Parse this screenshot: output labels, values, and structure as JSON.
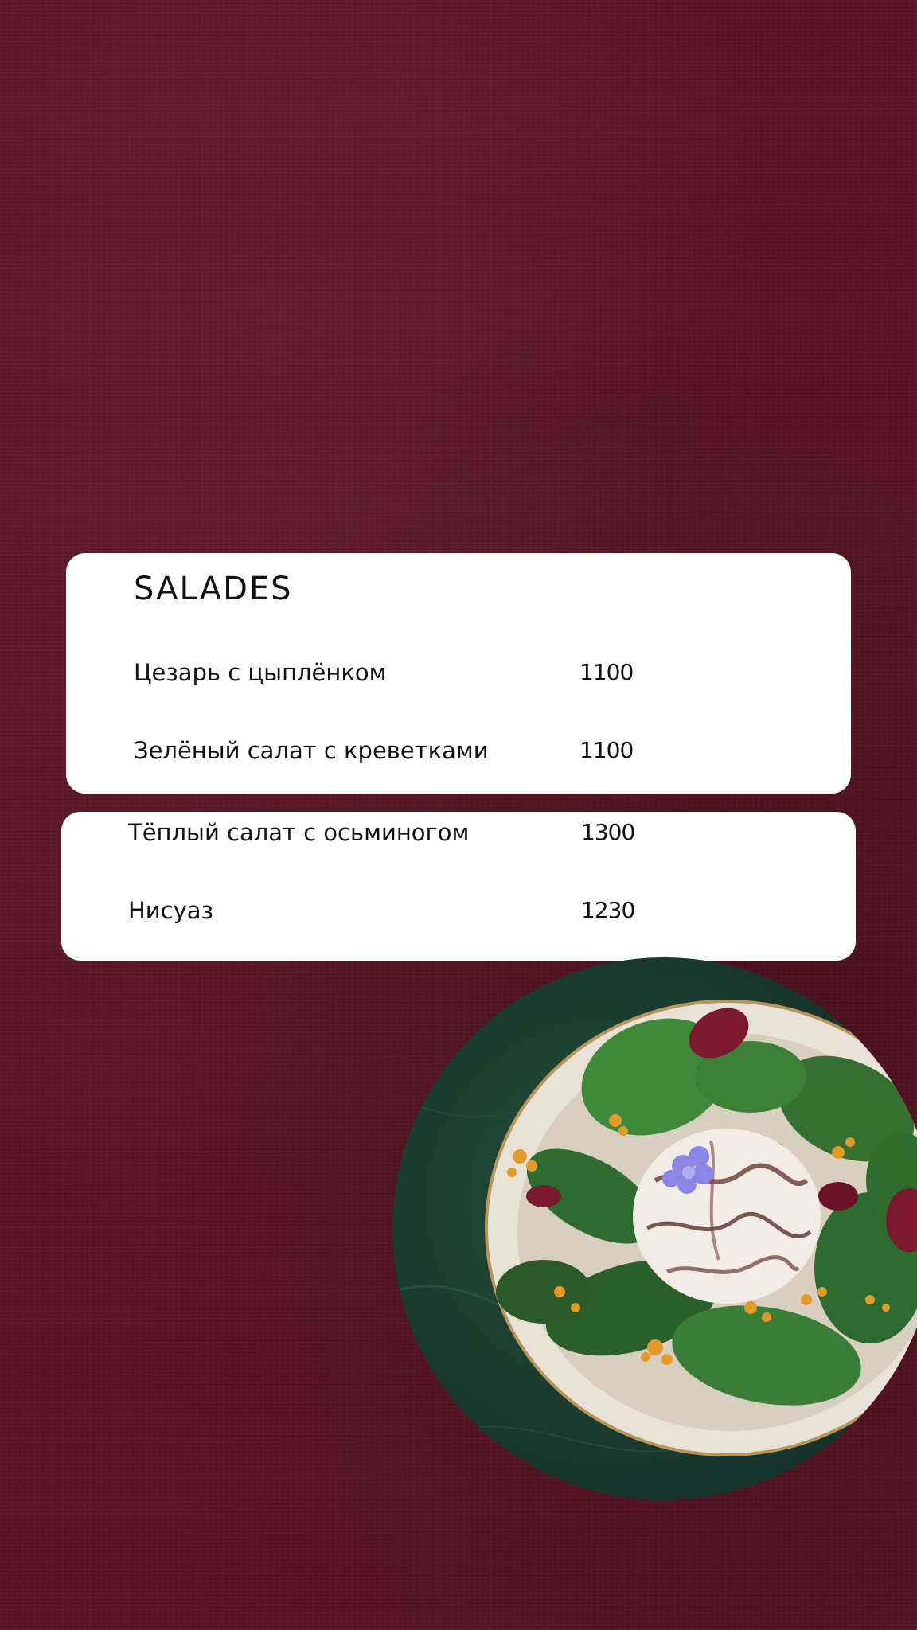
{
  "menu": {
    "section_title": "SALADES",
    "items": [
      {
        "name": "Цезарь с цыплёнком",
        "price": "1100"
      },
      {
        "name": "Зелёный салат с креветками",
        "price": "1100"
      },
      {
        "name": "Тёплый салат с осьминогом",
        "price": "1300"
      },
      {
        "name": "Нисуаз",
        "price": "1230"
      }
    ]
  },
  "colors": {
    "background": "#5a1325",
    "card": "#ffffff",
    "text": "#111111",
    "marble": "#1c3f31"
  },
  "photo": {
    "icon": "salad-bowl-photo"
  }
}
